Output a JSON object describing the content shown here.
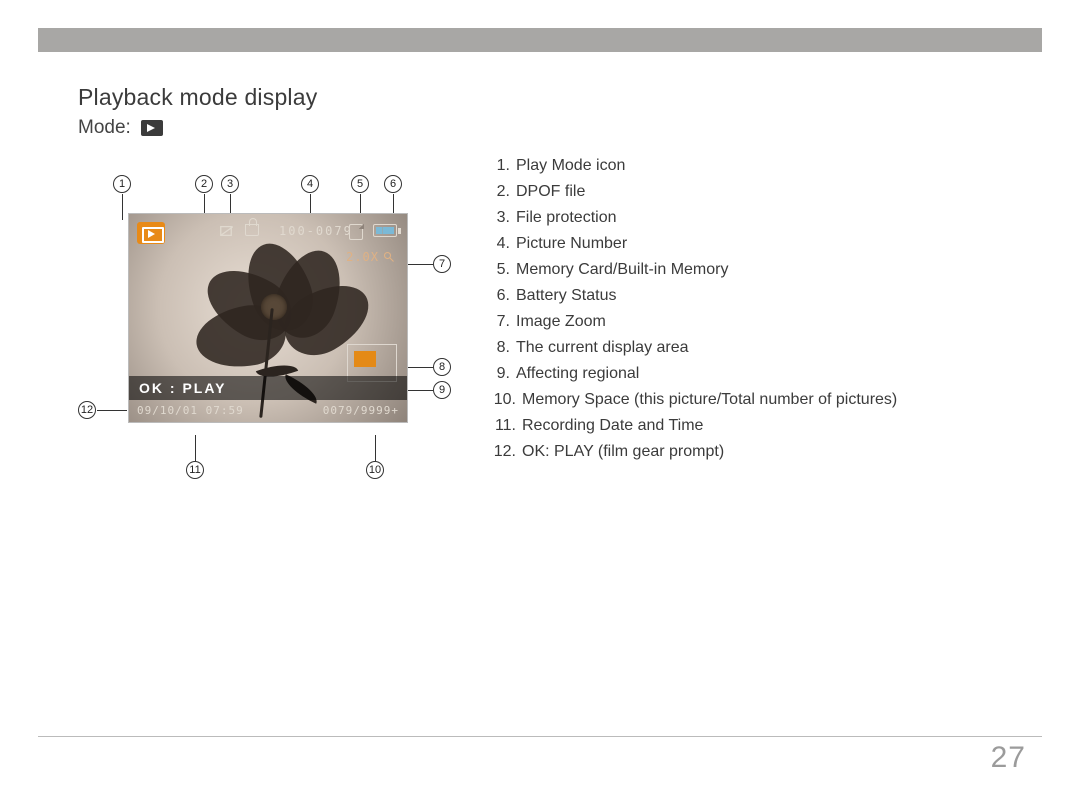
{
  "page_number": "27",
  "title": "Playback mode display",
  "mode_label": "Mode:",
  "lcd": {
    "picture_number": "100-0079",
    "zoom": "2.0X",
    "ok_text": "OK : PLAY",
    "datetime": "09/10/01 07:59",
    "memory_count": "0079/9999+"
  },
  "callouts": {
    "c1": "1",
    "c2": "2",
    "c3": "3",
    "c4": "4",
    "c5": "5",
    "c6": "6",
    "c7": "7",
    "c8": "8",
    "c9": "9",
    "c10": "10",
    "c11": "11",
    "c12": "12"
  },
  "legend": [
    {
      "n": "1.",
      "t": "Play Mode icon"
    },
    {
      "n": "2.",
      "t": "DPOF file"
    },
    {
      "n": "3.",
      "t": "File protection"
    },
    {
      "n": "4.",
      "t": "Picture Number"
    },
    {
      "n": "5.",
      "t": "Memory Card/Built-in Memory"
    },
    {
      "n": "6.",
      "t": "Battery Status"
    },
    {
      "n": "7.",
      "t": " Image Zoom"
    },
    {
      "n": "8.",
      "t": "The current display area"
    },
    {
      "n": "9.",
      "t": "Affecting regional"
    },
    {
      "n": "10.",
      "t": "Memory Space (this picture/Total number of pictures)"
    },
    {
      "n": "11.",
      "t": "Recording Date and Time"
    },
    {
      "n": "12.",
      "t": "OK: PLAY (film gear prompt)"
    }
  ]
}
